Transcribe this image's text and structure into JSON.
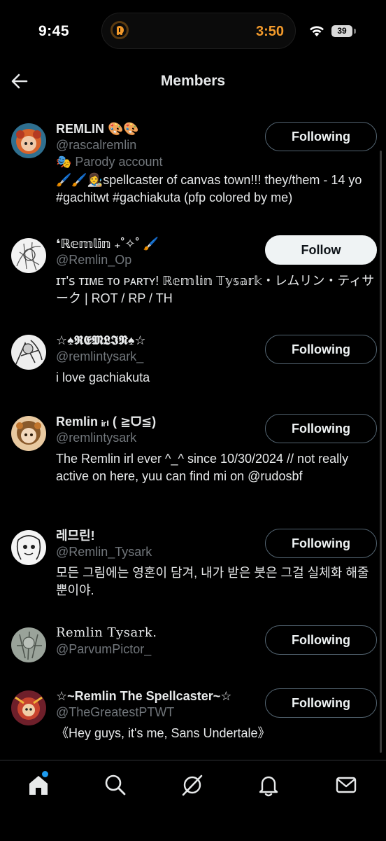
{
  "status_bar": {
    "time": "9:45",
    "timer": "3:50",
    "battery": "39"
  },
  "header": {
    "title": "Members"
  },
  "members": [
    {
      "name": "REMLIN 🎨🎨",
      "handle": "@rascalremlin",
      "parody": "🎭 Parody account",
      "bio": "🖌️🖌️👩‍🎨spellcaster of canvas town!!! they/them - 14 yo #gachitwt #gachiakuta (pfp colored by me)",
      "button": "Following"
    },
    {
      "name": "❛ℝ𝕖𝕞𝕝𝕚𝕟 ₊˚✧˚ 🖌️",
      "handle": "@Remlin_Op",
      "bio": "ɪᴛ'ꜱ ᴛɪᴍᴇ ᴛᴏ ᴘᴀʀᴛʏ! ℝ𝕖𝕞𝕝𝕚𝕟 𝕋𝕪𝕤𝕒𝕣𝕜・レムリン・ティサーク | ROT / RP / TH",
      "button": "Follow"
    },
    {
      "name": "☆♠𝕽𝕰𝕸𝕷𝕴𝕹♠☆",
      "handle": "@remlintysark_",
      "bio": "i love gachiakuta",
      "button": "Following"
    },
    {
      "name": "Remlin ᵢᵣₗ ( ≧ᗜ≦)",
      "handle": "@remlintysark",
      "bio": "The Remlin irl ever ^_^ since 10/30/2024 // not really active on here, yuu can find mi on @rudosbf",
      "button": "Following"
    },
    {
      "name": "레므린!",
      "handle": "@Remlin_Tysark",
      "bio": "모든 그림에는 영혼이 담겨, 내가 받은 붓은 그걸 실체화 해줄 뿐이야.",
      "button": "Following"
    },
    {
      "name": "Remlin Tysark.",
      "handle": "@ParvumPictor_",
      "bio": "",
      "button": "Following"
    },
    {
      "name": "☆~Remlin The Spellcaster~☆",
      "handle": "@TheGreatestPTWT",
      "bio": "《Hey guys, it's me, Sans Undertale》",
      "button": "Following"
    }
  ],
  "icons": {
    "back": "arrow-left-icon",
    "home": "home-icon",
    "search": "search-icon",
    "grok": "grok-icon",
    "notifications": "bell-icon",
    "messages": "mail-icon"
  },
  "colors": {
    "accent": "#1d9bf0",
    "timer": "#f39a2b",
    "muted": "#71767b"
  }
}
